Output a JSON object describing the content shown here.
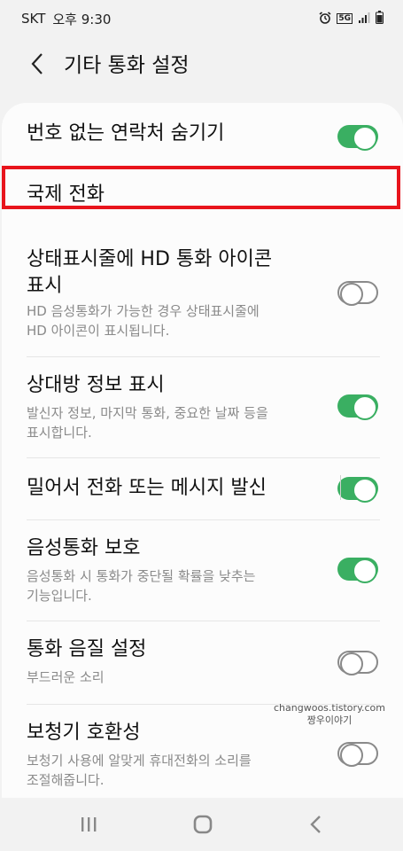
{
  "status_bar": {
    "carrier": "SKT",
    "time": "오후 9:30",
    "icons": [
      "alarm-icon",
      "5g-icon",
      "signal-icon",
      "battery-icon"
    ],
    "network_label": "5G"
  },
  "header": {
    "title": "기타 통화 설정",
    "back_icon": "chevron-left-icon"
  },
  "settings": [
    {
      "title": "번호 없는 연락처 숨기기",
      "subtitle": "",
      "toggle": true
    },
    {
      "title": "국제 전화",
      "subtitle": "",
      "toggle": null,
      "highlighted": true
    },
    {
      "title_line1": "상태표시줄에 HD 통화 아이콘",
      "title_line2": "표시",
      "subtitle_line1": "HD 음성통화가 가능한 경우 상태표시줄에",
      "subtitle_line2": "HD 아이콘이 표시됩니다.",
      "toggle": false
    },
    {
      "title": "상대방 정보 표시",
      "subtitle_line1": "발신자 정보, 마지막 통화, 중요한 날짜 등을",
      "subtitle_line2": "표시합니다.",
      "toggle": true
    },
    {
      "title": "밀어서 전화 또는 메시지 발신",
      "subtitle": "",
      "toggle": true
    },
    {
      "title": "음성통화 보호",
      "subtitle_line1": "음성통화 시 통화가 중단될 확률을 낮추는",
      "subtitle_line2": "기능입니다.",
      "toggle": true
    },
    {
      "title": "통화 음질 설정",
      "subtitle": "부드러운 소리",
      "toggle": false
    },
    {
      "title": "보청기 호환성",
      "subtitle_line1": "보청기 사용에 알맞게 휴대전화의 소리를",
      "subtitle_line2": "조절해줍니다.",
      "toggle": false
    }
  ],
  "watermark": {
    "line1": "changwoos.tistory.com",
    "line2": "짱우이야기"
  },
  "nav_bar": {
    "icons": [
      "recent-apps-icon",
      "home-icon",
      "back-icon"
    ]
  },
  "colors": {
    "toggle_on": "#3aaf62",
    "highlight": "#e8141c",
    "background": "#f2f2f2",
    "card": "#fcfcfc"
  }
}
